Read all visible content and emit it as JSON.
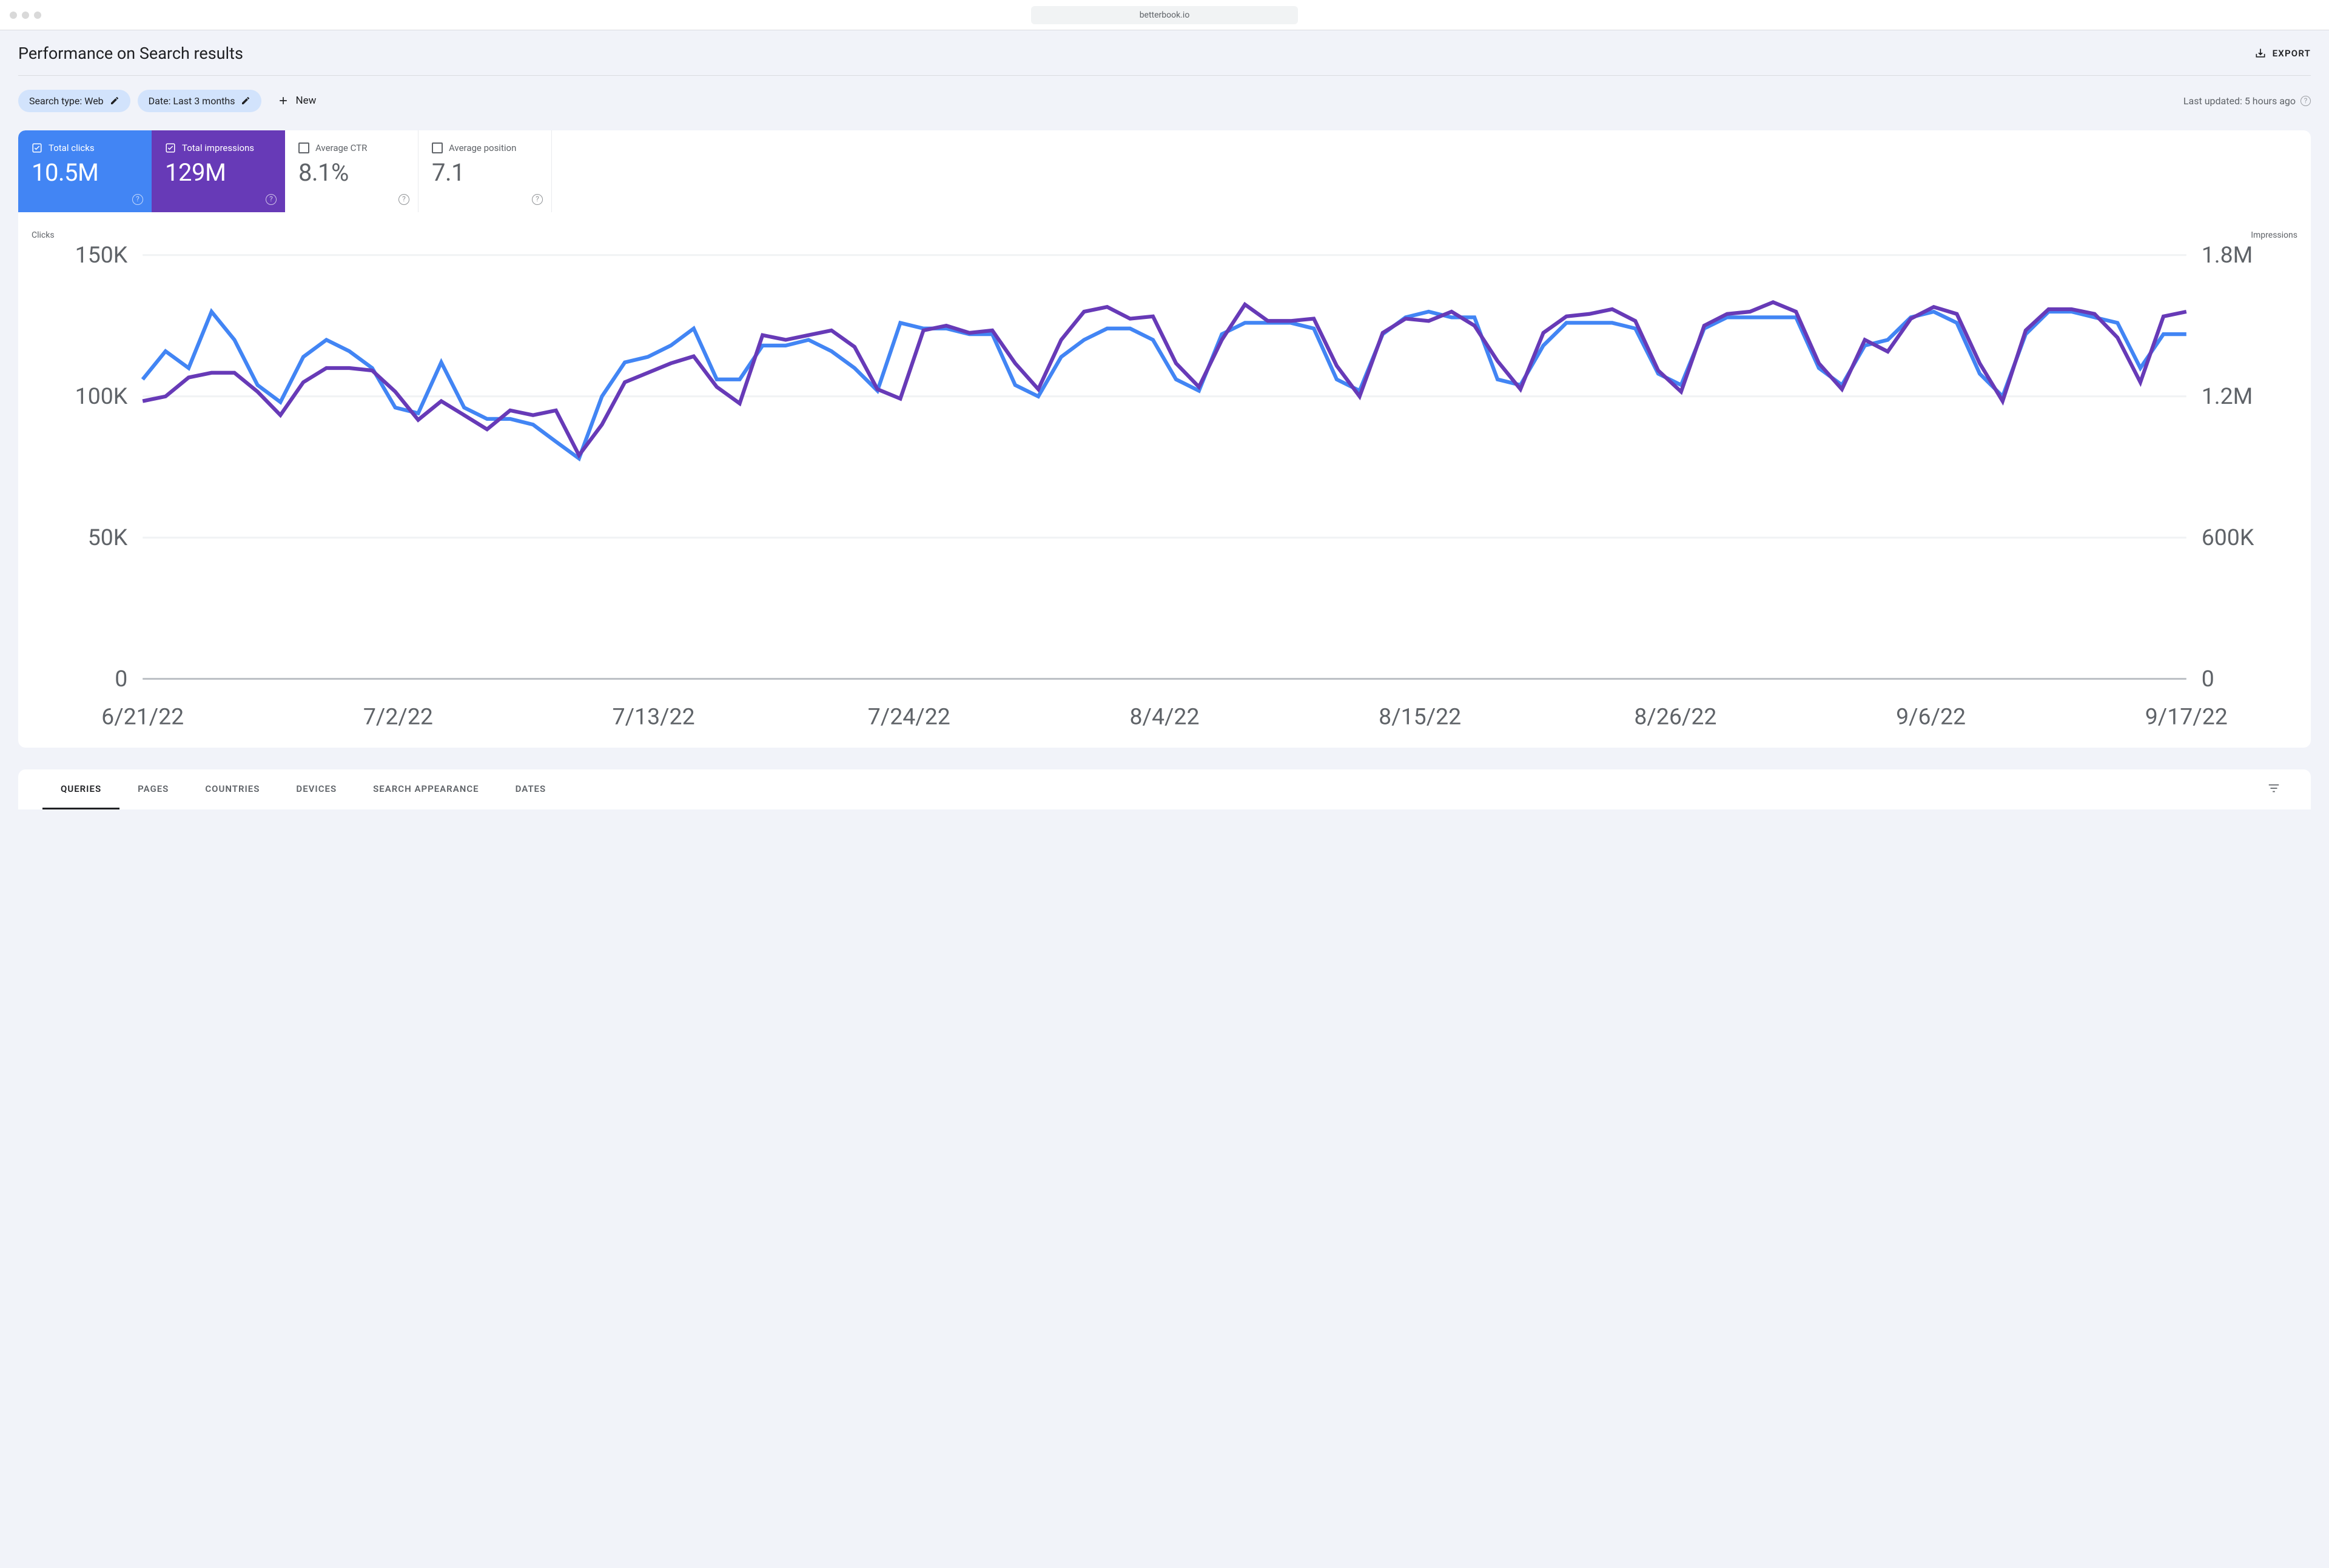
{
  "browser": {
    "url": "betterbook.io"
  },
  "header": {
    "title": "Performance on Search results",
    "export_label": "EXPORT"
  },
  "filters": {
    "search_type_chip": "Search type: Web",
    "date_chip": "Date: Last 3 months",
    "new_label": "New",
    "last_updated": "Last updated: 5 hours ago"
  },
  "metrics": {
    "clicks": {
      "label": "Total clicks",
      "value": "10.5M",
      "active": true
    },
    "impressions": {
      "label": "Total impressions",
      "value": "129M",
      "active": true
    },
    "ctr": {
      "label": "Average CTR",
      "value": "8.1%",
      "active": false
    },
    "position": {
      "label": "Average position",
      "value": "7.1",
      "active": false
    }
  },
  "chart": {
    "left_axis_label": "Clicks",
    "right_axis_label": "Impressions",
    "left_ticks": [
      "150K",
      "100K",
      "50K",
      "0"
    ],
    "right_ticks": [
      "1.8M",
      "1.2M",
      "600K",
      "0"
    ],
    "x_ticks": [
      "6/21/22",
      "7/2/22",
      "7/13/22",
      "7/24/22",
      "8/4/22",
      "8/15/22",
      "8/26/22",
      "9/6/22",
      "9/17/22"
    ]
  },
  "tabs": {
    "items": [
      "QUERIES",
      "PAGES",
      "COUNTRIES",
      "DEVICES",
      "SEARCH APPEARANCE",
      "DATES"
    ],
    "active_index": 0
  },
  "chart_data": {
    "type": "line",
    "xlabel": "",
    "ylabel_left": "Clicks",
    "ylabel_right": "Impressions",
    "ylim_left": [
      0,
      150000
    ],
    "ylim_right": [
      0,
      1800000
    ],
    "x": [
      "6/21/22",
      "6/22/22",
      "6/23/22",
      "6/24/22",
      "6/25/22",
      "6/26/22",
      "6/27/22",
      "6/28/22",
      "6/29/22",
      "6/30/22",
      "7/1/22",
      "7/2/22",
      "7/3/22",
      "7/4/22",
      "7/5/22",
      "7/6/22",
      "7/7/22",
      "7/8/22",
      "7/9/22",
      "7/10/22",
      "7/11/22",
      "7/12/22",
      "7/13/22",
      "7/14/22",
      "7/15/22",
      "7/16/22",
      "7/17/22",
      "7/18/22",
      "7/19/22",
      "7/20/22",
      "7/21/22",
      "7/22/22",
      "7/23/22",
      "7/24/22",
      "7/25/22",
      "7/26/22",
      "7/27/22",
      "7/28/22",
      "7/29/22",
      "7/30/22",
      "7/31/22",
      "8/1/22",
      "8/2/22",
      "8/3/22",
      "8/4/22",
      "8/5/22",
      "8/6/22",
      "8/7/22",
      "8/8/22",
      "8/9/22",
      "8/10/22",
      "8/11/22",
      "8/12/22",
      "8/13/22",
      "8/14/22",
      "8/15/22",
      "8/16/22",
      "8/17/22",
      "8/18/22",
      "8/19/22",
      "8/20/22",
      "8/21/22",
      "8/22/22",
      "8/23/22",
      "8/24/22",
      "8/25/22",
      "8/26/22",
      "8/27/22",
      "8/28/22",
      "8/29/22",
      "8/30/22",
      "8/31/22",
      "9/1/22",
      "9/2/22",
      "9/3/22",
      "9/4/22",
      "9/5/22",
      "9/6/22",
      "9/7/22",
      "9/8/22",
      "9/9/22",
      "9/10/22",
      "9/11/22",
      "9/12/22",
      "9/13/22",
      "9/14/22",
      "9/15/22",
      "9/16/22",
      "9/17/22",
      "9/18/22"
    ],
    "series": [
      {
        "name": "Clicks",
        "axis": "left",
        "color": "#4285f4",
        "values": [
          106000,
          116000,
          110000,
          130000,
          120000,
          104000,
          98000,
          114000,
          120000,
          116000,
          110000,
          96000,
          94000,
          112000,
          96000,
          92000,
          92000,
          90000,
          84000,
          78000,
          100000,
          112000,
          114000,
          118000,
          124000,
          106000,
          106000,
          118000,
          118000,
          120000,
          116000,
          110000,
          102000,
          126000,
          124000,
          124000,
          122000,
          122000,
          104000,
          100000,
          114000,
          120000,
          124000,
          124000,
          120000,
          106000,
          102000,
          122000,
          126000,
          126000,
          126000,
          124000,
          106000,
          102000,
          122000,
          128000,
          130000,
          128000,
          128000,
          106000,
          104000,
          118000,
          126000,
          126000,
          126000,
          124000,
          108000,
          104000,
          124000,
          128000,
          128000,
          128000,
          128000,
          110000,
          104000,
          118000,
          120000,
          128000,
          130000,
          126000,
          108000,
          100000,
          122000,
          130000,
          130000,
          128000,
          126000,
          110000,
          122000,
          122000
        ]
      },
      {
        "name": "Impressions",
        "axis": "right",
        "color": "#673ab7",
        "values": [
          1180000,
          1200000,
          1280000,
          1300000,
          1300000,
          1220000,
          1120000,
          1260000,
          1320000,
          1320000,
          1310000,
          1220000,
          1100000,
          1180000,
          1120000,
          1060000,
          1140000,
          1120000,
          1140000,
          950000,
          1080000,
          1260000,
          1300000,
          1340000,
          1370000,
          1240000,
          1170000,
          1460000,
          1440000,
          1460000,
          1480000,
          1410000,
          1230000,
          1190000,
          1480000,
          1500000,
          1470000,
          1480000,
          1340000,
          1230000,
          1440000,
          1560000,
          1580000,
          1530000,
          1540000,
          1340000,
          1240000,
          1440000,
          1590000,
          1520000,
          1520000,
          1530000,
          1330000,
          1200000,
          1470000,
          1530000,
          1520000,
          1560000,
          1500000,
          1350000,
          1230000,
          1470000,
          1540000,
          1550000,
          1570000,
          1520000,
          1310000,
          1220000,
          1500000,
          1550000,
          1560000,
          1600000,
          1560000,
          1340000,
          1230000,
          1440000,
          1390000,
          1530000,
          1580000,
          1550000,
          1340000,
          1180000,
          1480000,
          1570000,
          1570000,
          1550000,
          1450000,
          1260000,
          1540000,
          1560000
        ]
      }
    ]
  }
}
